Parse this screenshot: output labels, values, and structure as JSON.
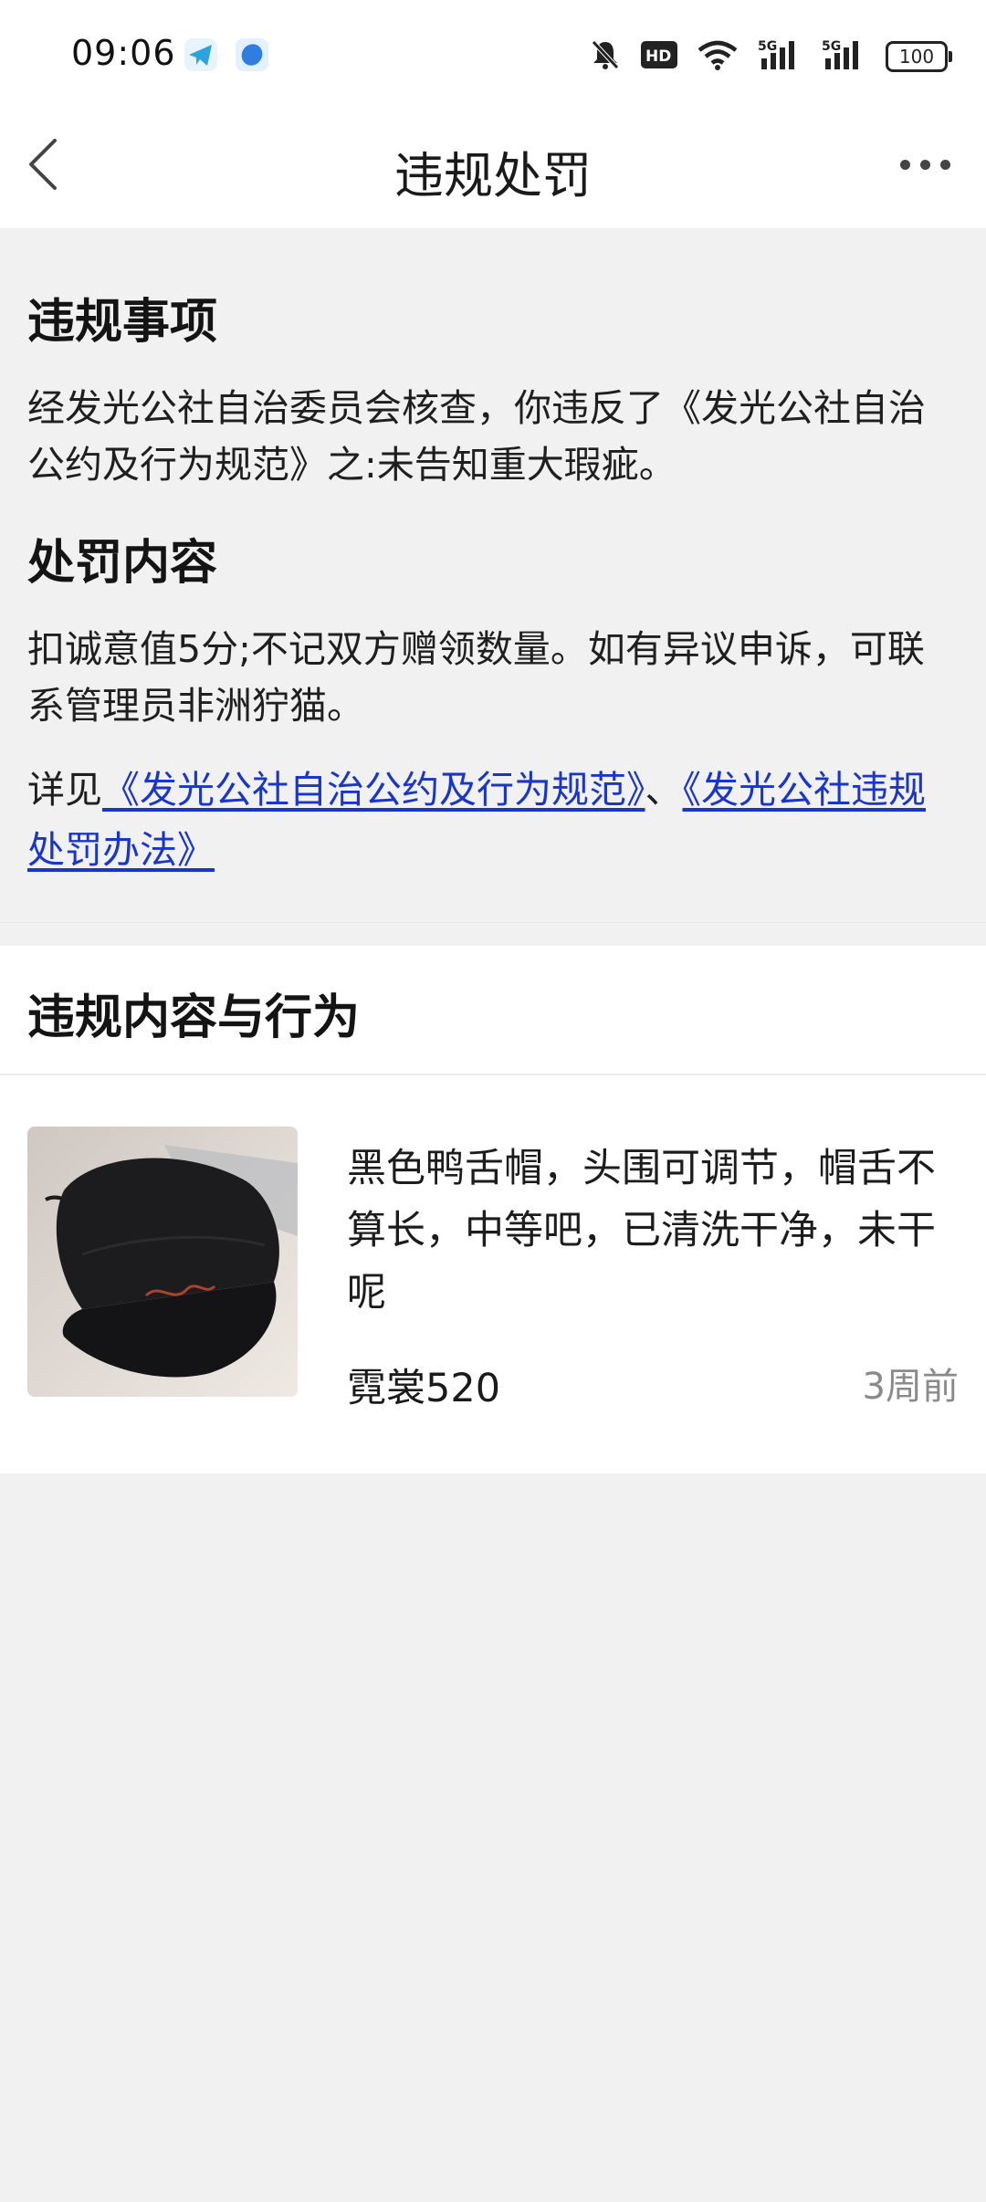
{
  "status_bar": {
    "time": "09:06",
    "battery": "100",
    "icons": [
      "telegram-app-icon",
      "blue-app-icon",
      "bell-muted-icon",
      "hd-icon",
      "wifi-icon",
      "5g-signal-icon",
      "5g-signal-icon",
      "battery-icon"
    ]
  },
  "nav": {
    "title": "违规处罚",
    "back_icon": "chevron-left-icon",
    "more_icon": "more-horizontal-icon"
  },
  "violation": {
    "heading": "违规事项",
    "text": "经发光公社自治委员会核查，你违反了《发光公社自治公约及行为规范》之:未告知重大瑕疵。"
  },
  "penalty": {
    "heading": "处罚内容",
    "text": "扣诚意值5分;不记双方赠领数量。如有异议申诉，可联系管理员非洲狞猫。",
    "see_prefix": "详见",
    "link1": "《发光公社自治公约及行为规范》",
    "separator": "、",
    "link2": "《发光公社违规处罚办法》"
  },
  "card": {
    "title": "违规内容与行为",
    "item": {
      "description": "黑色鸭舌帽，头围可调节，帽舌不算长，中等吧，已清洗干净，未干呢",
      "user": "霓裳520",
      "time": "3周前",
      "image": "black-baseball-cap-photo"
    }
  },
  "colors": {
    "background": "#f1f1f1",
    "card": "#ffffff",
    "link": "#1a35c9",
    "muted_text": "#8a8a8a"
  }
}
